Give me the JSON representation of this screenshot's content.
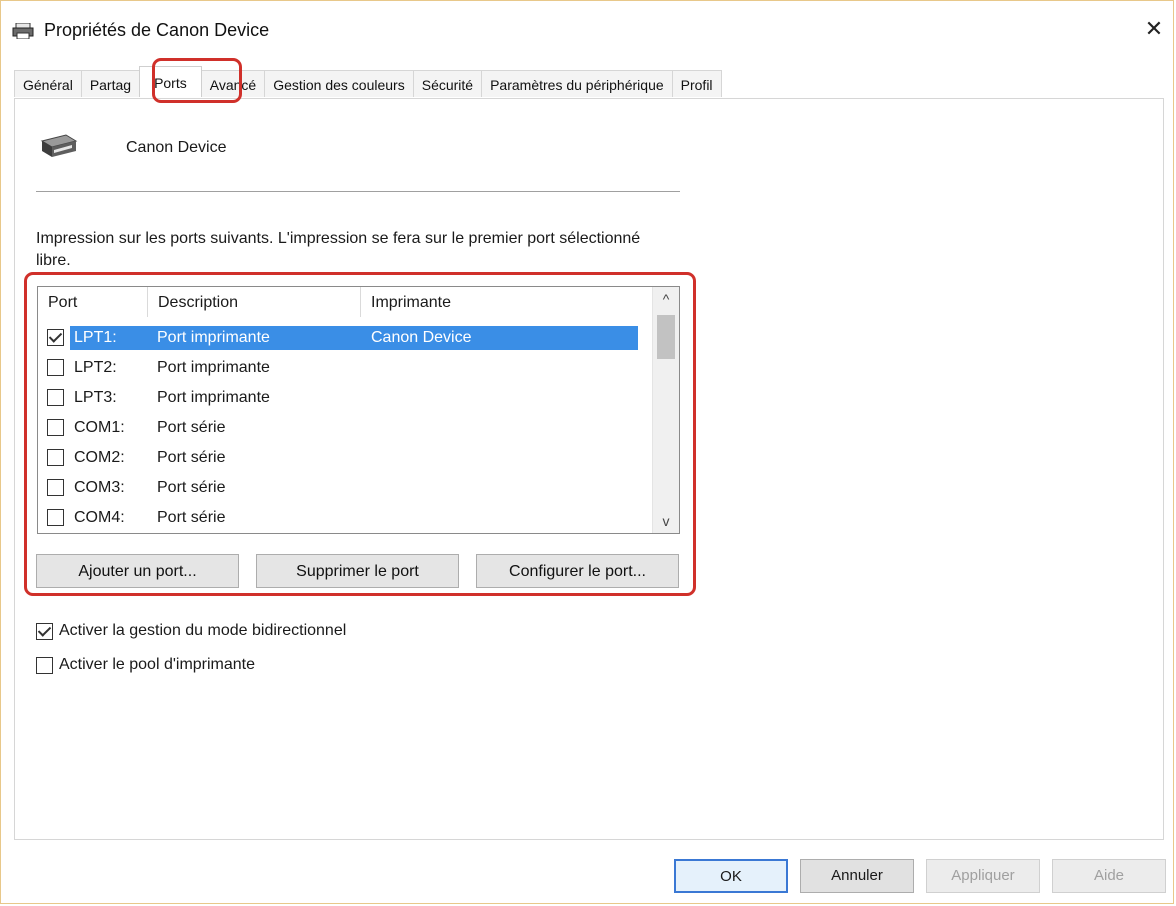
{
  "window": {
    "title": "Propriétés de Canon Device",
    "close_glyph": "✕"
  },
  "tabs": [
    {
      "label": "Général"
    },
    {
      "label": "Partag"
    },
    {
      "label": "Ports"
    },
    {
      "label": "Avancé"
    },
    {
      "label": "Gestion des couleurs"
    },
    {
      "label": "Sécurité"
    },
    {
      "label": "Paramètres du périphérique"
    },
    {
      "label": "Profil"
    }
  ],
  "active_tab": "Ports",
  "printer": {
    "name": "Canon Device"
  },
  "description": "Impression sur les ports suivants. L'impression se fera sur le premier port sélectionné libre.",
  "ports_list": {
    "columns": [
      "Port",
      "Description",
      "Imprimante"
    ],
    "rows": [
      {
        "port": "LPT1:",
        "description": "Port imprimante",
        "printer": "Canon Device",
        "checked": true,
        "selected": true
      },
      {
        "port": "LPT2:",
        "description": "Port imprimante",
        "printer": "",
        "checked": false,
        "selected": false
      },
      {
        "port": "LPT3:",
        "description": "Port imprimante",
        "printer": "",
        "checked": false,
        "selected": false
      },
      {
        "port": "COM1:",
        "description": "Port série",
        "printer": "",
        "checked": false,
        "selected": false
      },
      {
        "port": "COM2:",
        "description": "Port série",
        "printer": "",
        "checked": false,
        "selected": false
      },
      {
        "port": "COM3:",
        "description": "Port série",
        "printer": "",
        "checked": false,
        "selected": false
      },
      {
        "port": "COM4:",
        "description": "Port série",
        "printer": "",
        "checked": false,
        "selected": false
      }
    ],
    "scroll_up_glyph": "^",
    "scroll_down_glyph": "v"
  },
  "port_buttons": {
    "add": "Ajouter un port...",
    "delete": "Supprimer le port",
    "configure": "Configurer le port..."
  },
  "options": {
    "bidirectional": {
      "label": "Activer la gestion du mode bidirectionnel",
      "checked": true
    },
    "pool": {
      "label": "Activer le pool d'imprimante",
      "checked": false
    }
  },
  "dialog_buttons": {
    "ok": "OK",
    "cancel": "Annuler",
    "apply": "Appliquer",
    "help": "Aide"
  },
  "colors": {
    "selection": "#3a8ee6",
    "highlight": "#d0302a"
  },
  "icons": {
    "title": "printer-icon",
    "device": "printer-icon",
    "close": "close-icon"
  }
}
